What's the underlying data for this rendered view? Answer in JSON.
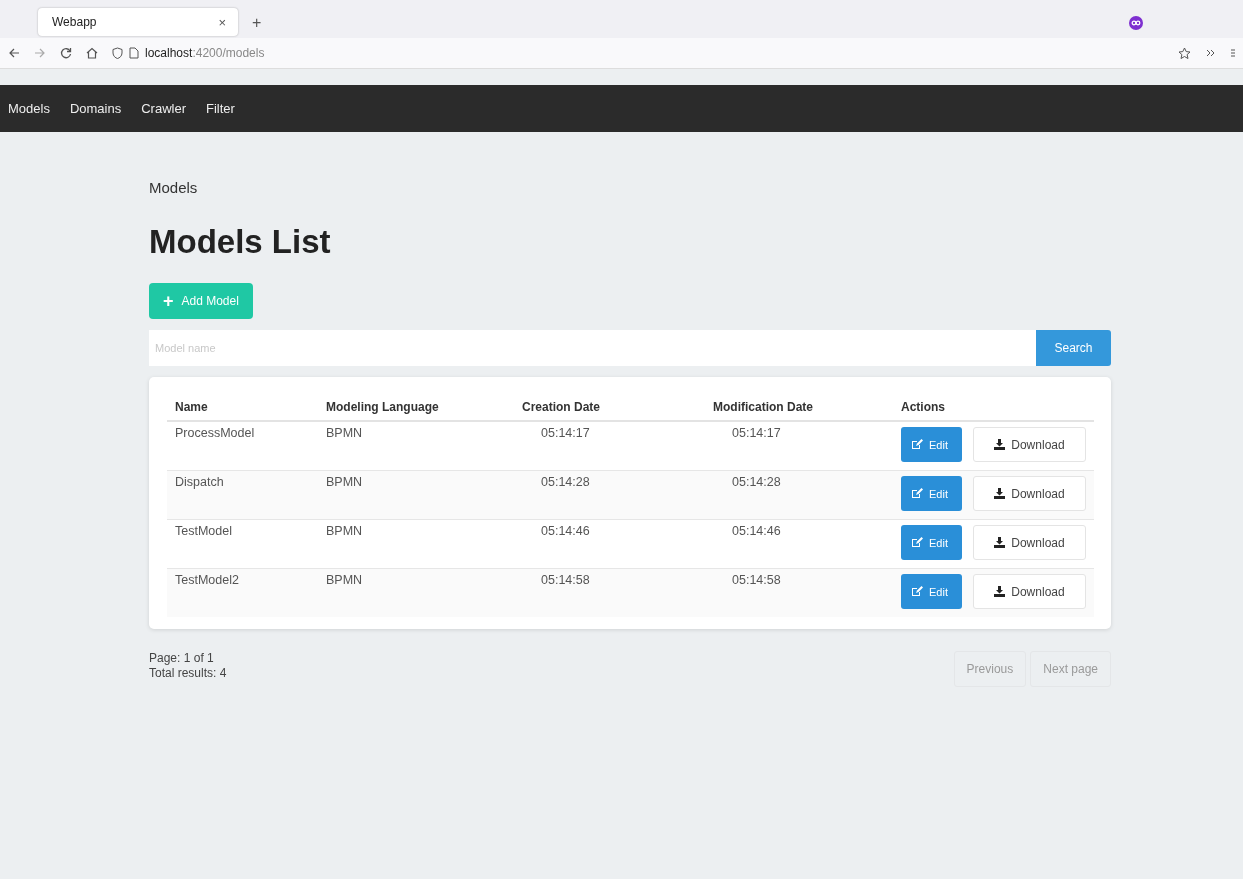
{
  "browser": {
    "tab": {
      "title": "Webapp",
      "close": "×"
    },
    "new_tab": "+",
    "address": {
      "host": "localhost",
      "path": ":4200/models"
    }
  },
  "navbar": {
    "items": [
      {
        "label": "Models"
      },
      {
        "label": "Domains"
      },
      {
        "label": "Crawler"
      },
      {
        "label": "Filter"
      }
    ]
  },
  "breadcrumb": "Models",
  "title": "Models List",
  "add_button": {
    "icon": "+",
    "label": "Add Model"
  },
  "search": {
    "placeholder": "Model name",
    "button": "Search"
  },
  "table": {
    "columns": [
      "Name",
      "Modeling Language",
      "Creation Date",
      "Modification Date",
      "Actions"
    ],
    "rows": [
      {
        "name": "ProcessModel",
        "language": "BPMN",
        "created": "05:14:17",
        "modified": "05:14:17",
        "edit": "Edit",
        "download": "Download"
      },
      {
        "name": "Dispatch",
        "language": "BPMN",
        "created": "05:14:28",
        "modified": "05:14:28",
        "edit": "Edit",
        "download": "Download"
      },
      {
        "name": "TestModel",
        "language": "BPMN",
        "created": "05:14:46",
        "modified": "05:14:46",
        "edit": "Edit",
        "download": "Download"
      },
      {
        "name": "TestModel2",
        "language": "BPMN",
        "created": "05:14:58",
        "modified": "05:14:58",
        "edit": "Edit",
        "download": "Download"
      }
    ]
  },
  "pagination": {
    "page": "Page: 1 of 1",
    "total": "Total results: 4",
    "buttons": [
      {
        "label": "Previous",
        "disabled": true
      },
      {
        "label": "Next page",
        "disabled": true
      }
    ]
  }
}
